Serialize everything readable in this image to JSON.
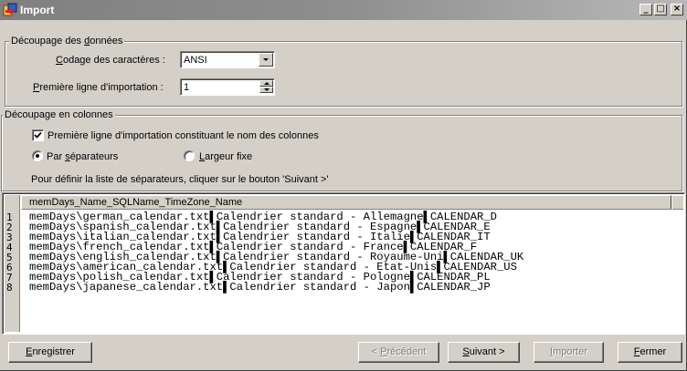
{
  "window": {
    "title": "Import",
    "controls": {
      "minimize": "_",
      "maximize": "□",
      "close": "×"
    }
  },
  "group_data": {
    "title_parts": [
      "Découpage des ",
      "d",
      "onnées"
    ],
    "encoding_label_parts": [
      "C",
      "odage des caractères :"
    ],
    "encoding_value": "ANSI",
    "first_line_label_parts": [
      "P",
      "remière ligne d'importation :"
    ],
    "first_line_value": "1"
  },
  "group_columns": {
    "title": "Découpage en colonnes",
    "header_checkbox_label": "Première ligne d'importation constituant le nom des colonnes",
    "header_checkbox_checked": true,
    "radio_separators_parts": [
      "Par ",
      "s",
      "éparateurs"
    ],
    "radio_separators_selected": true,
    "radio_fixed_parts": [
      "L",
      "argeur fixe"
    ],
    "radio_fixed_selected": false,
    "hint": "Pour définir la liste de séparateurs, cliquer sur le bouton 'Suivant >'"
  },
  "preview": {
    "column_header": "memDays_Name_SQLName_TimeZone_Name",
    "rows": [
      {
        "num": "1",
        "text": "memDays\\german_calendar.txt▌Calendrier standard - Allemagne▌CALENDAR_D"
      },
      {
        "num": "2",
        "text": "memDays\\spanish_calendar.txt▌Calendrier standard - Espagne▌CALENDAR_E"
      },
      {
        "num": "3",
        "text": "memDays\\italian_calendar.txt▌Calendrier standard - Italie▌CALENDAR_IT"
      },
      {
        "num": "4",
        "text": "memDays\\french_calendar.txt▌Calendrier standard - France▌CALENDAR_F"
      },
      {
        "num": "5",
        "text": "memDays\\english_calendar.txt▌Calendrier standard - Royaume-Uni▌CALENDAR_UK"
      },
      {
        "num": "6",
        "text": "memDays\\american_calendar.txt▌Calendrier standard - Etat-Unis▌CALENDAR_US"
      },
      {
        "num": "7",
        "text": "memDays\\polish_calendar.txt▌Calendrier standard - Pologne▌CALENDAR_PL"
      },
      {
        "num": "8",
        "text": "memDays\\japanese_calendar.txt▌Calendrier standard - Japon▌CALENDAR_JP"
      }
    ]
  },
  "buttons": {
    "save_parts": [
      "E",
      "nregistrer"
    ],
    "previous_parts": [
      "< ",
      "P",
      "récédent"
    ],
    "next_parts": [
      "S",
      "uivant >"
    ],
    "import_parts": [
      "I",
      "mporter"
    ],
    "close_parts": [
      "F",
      "ermer"
    ]
  }
}
